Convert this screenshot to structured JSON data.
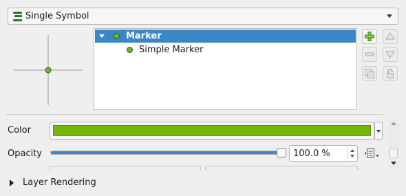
{
  "renderer": {
    "selected": "Single Symbol",
    "icon": "single-symbol-renderer-icon"
  },
  "symbol_layers": {
    "items": [
      {
        "label": "Marker",
        "selected": true,
        "expanded": true
      },
      {
        "label": "Simple Marker",
        "selected": false
      }
    ]
  },
  "layer_buttons": [
    "add-symbol-layer-icon",
    "remove-symbol-layer-icon",
    "duplicate-symbol-layer-icon",
    "move-up-icon",
    "move-down-icon",
    "lock-color-icon"
  ],
  "color": {
    "label": "Color",
    "value": "#75b908"
  },
  "opacity": {
    "label": "Opacity",
    "value_text": "100.0 %",
    "fraction": 1.0
  },
  "layer_rendering": {
    "label": "Layer Rendering"
  },
  "colors": {
    "selection": "#3a87c8",
    "marker_fill": "#72b42c"
  }
}
